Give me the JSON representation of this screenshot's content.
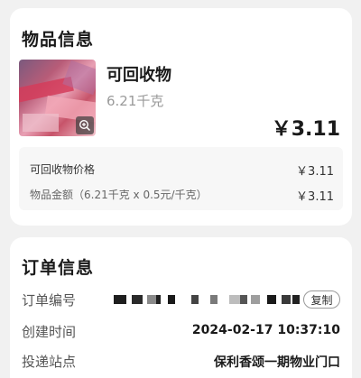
{
  "item_card": {
    "title": "物品信息",
    "item_name": "可回收物",
    "item_weight": "6.21千克",
    "item_price": "￥3.11",
    "thumbnail_icon": "zoom-in-icon",
    "details": [
      {
        "label": "可回收物价格",
        "value": "￥3.11"
      },
      {
        "label": "物品金额（6.21千克 x 0.5元/千克）",
        "value": "￥3.11"
      }
    ]
  },
  "order_card": {
    "title": "订单信息",
    "order_number_label": "订单编号",
    "copy_label": "复制",
    "created_time_label": "创建时间",
    "created_time_value": "2024-02-17 10:37:10",
    "station_label": "投递站点",
    "station_value": "保利香颂一期物业门口"
  },
  "colors": {
    "page_background": "#f1f1f1",
    "card_background": "#ffffff",
    "detail_box_background": "#f7f7f7",
    "secondary_text": "#9a9a9a"
  }
}
